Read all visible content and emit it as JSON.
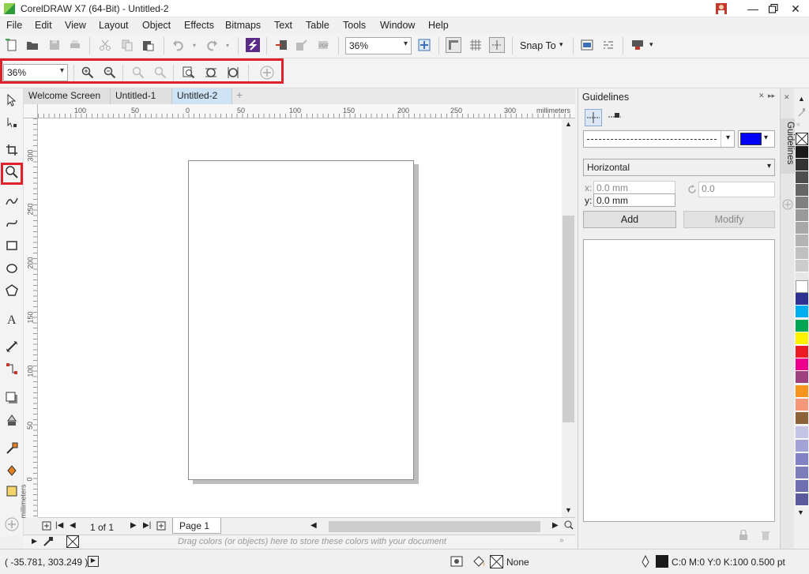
{
  "window": {
    "title": "CorelDRAW X7 (64-Bit) - Untitled-2"
  },
  "menu": [
    {
      "label": "File",
      "key": "F"
    },
    {
      "label": "Edit",
      "key": "E"
    },
    {
      "label": "View",
      "key": "V"
    },
    {
      "label": "Layout",
      "key": "L"
    },
    {
      "label": "Object",
      "key": "j"
    },
    {
      "label": "Effects",
      "key": "C"
    },
    {
      "label": "Bitmaps",
      "key": "B"
    },
    {
      "label": "Text",
      "key": "x"
    },
    {
      "label": "Table",
      "key": "T"
    },
    {
      "label": "Tools",
      "key": "o"
    },
    {
      "label": "Window",
      "key": "W"
    },
    {
      "label": "Help",
      "key": "H"
    }
  ],
  "standard_toolbar": {
    "zoom_value": "36%",
    "snap_to_label": "Snap To"
  },
  "zoom_toolbar": {
    "zoom_value": "36%"
  },
  "tabs": [
    "Welcome Screen",
    "Untitled-1",
    "Untitled-2"
  ],
  "active_tab": "Untitled-2",
  "ruler": {
    "h_labels": [
      "100",
      "50",
      "0",
      "50",
      "100",
      "150",
      "200",
      "250",
      "300"
    ],
    "h_units": "millimeters",
    "v_labels": [
      "300",
      "250",
      "200",
      "150",
      "100",
      "50",
      "0"
    ],
    "v_units": "millimeters"
  },
  "page_nav": {
    "page_count": "1 of 1",
    "page_tab": "Page 1"
  },
  "color_well_hint": "Drag colors (or objects) here to store these colors with your document",
  "docker": {
    "title": "Guidelines",
    "orientation": "Horizontal",
    "x_value": "0.0 mm",
    "y_value": "0.0 mm",
    "angle_value": "0.0",
    "x_label": "x:",
    "y_label": "y:",
    "add_label": "Add",
    "modify_label": "Modify",
    "guide_color": "#0000ff"
  },
  "side_tab": "Guidelines",
  "palette": [
    "#ffffff",
    "#1a1a1a",
    "#333333",
    "#4d4d4d",
    "#666666",
    "#808080",
    "#999999",
    "#b3b3b3",
    "#cccccc",
    "#e6e6e6",
    "#ffffff",
    "#2e3192",
    "#00aeef",
    "#00a651",
    "#fff200",
    "#ed1c24",
    "#ec008c",
    "#92278f",
    "#f7941d",
    "#f69679",
    "#8c6239",
    "#c4c4e6",
    "#a3a3d8",
    "#8181c3",
    "#6d6db0",
    "#5a5a9c"
  ],
  "status": {
    "coords": "( -35.781, 303.249 )",
    "fill_label": "None",
    "outline_label": "C:0 M:0 Y:0 K:100  0.500 pt"
  }
}
